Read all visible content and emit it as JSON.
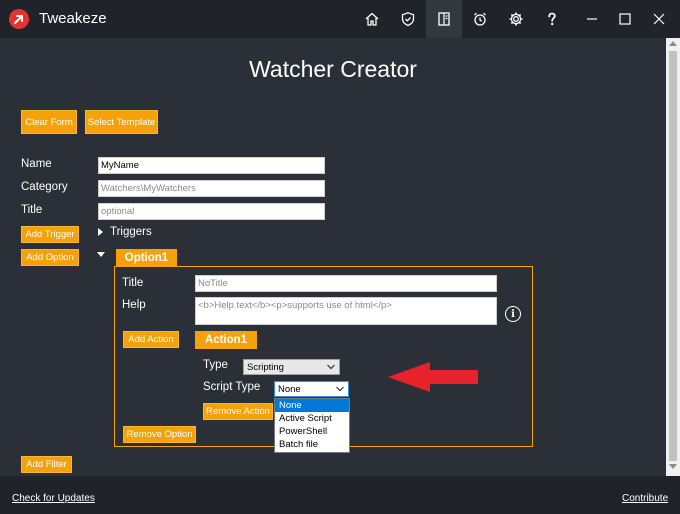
{
  "app": {
    "title": "Tweakeze"
  },
  "toolbar": {
    "icons": [
      "home-icon",
      "shield-icon",
      "book-icon",
      "alarm-clock-icon",
      "gear-icon",
      "help-icon"
    ],
    "active": "book-icon"
  },
  "window_controls": [
    "minimize",
    "maximize",
    "close"
  ],
  "page": {
    "heading": "Watcher Creator"
  },
  "buttons": {
    "clear_form": "Clear Form",
    "select_template": "Select Template",
    "add_trigger": "Add Trigger",
    "add_option": "Add Option",
    "add_action": "Add Action",
    "remove_action": "Remove Action",
    "remove_option": "Remove Option",
    "add_filter": "Add Filter"
  },
  "form": {
    "name_label": "Name",
    "name_value": "MyName",
    "category_label": "Category",
    "category_value": "Watchers\\MyWatchers",
    "title_label": "Title",
    "title_placeholder": "optional",
    "triggers_label": "Triggers"
  },
  "option": {
    "tab_label": "Option1",
    "title_label": "Title",
    "title_placeholder": "NoTitle",
    "help_label": "Help",
    "help_placeholder": "<b>Help text</b><p>supports use of html</p>"
  },
  "action": {
    "tab_label": "Action1",
    "type_label": "Type",
    "type_value": "Scripting",
    "script_type_label": "Script Type",
    "script_type_value": "None",
    "script_type_options": [
      "None",
      "Active Script",
      "PowerShell",
      "Batch file"
    ],
    "selected_option_index": 0
  },
  "colors": {
    "accent": "#f5a20a",
    "background": "#2b3038",
    "titlebar": "#20242a",
    "arrow": "#e8222a",
    "selection": "#0078d7"
  },
  "footer": {
    "check_updates": "Check for Updates",
    "contribute": "Contribute"
  }
}
